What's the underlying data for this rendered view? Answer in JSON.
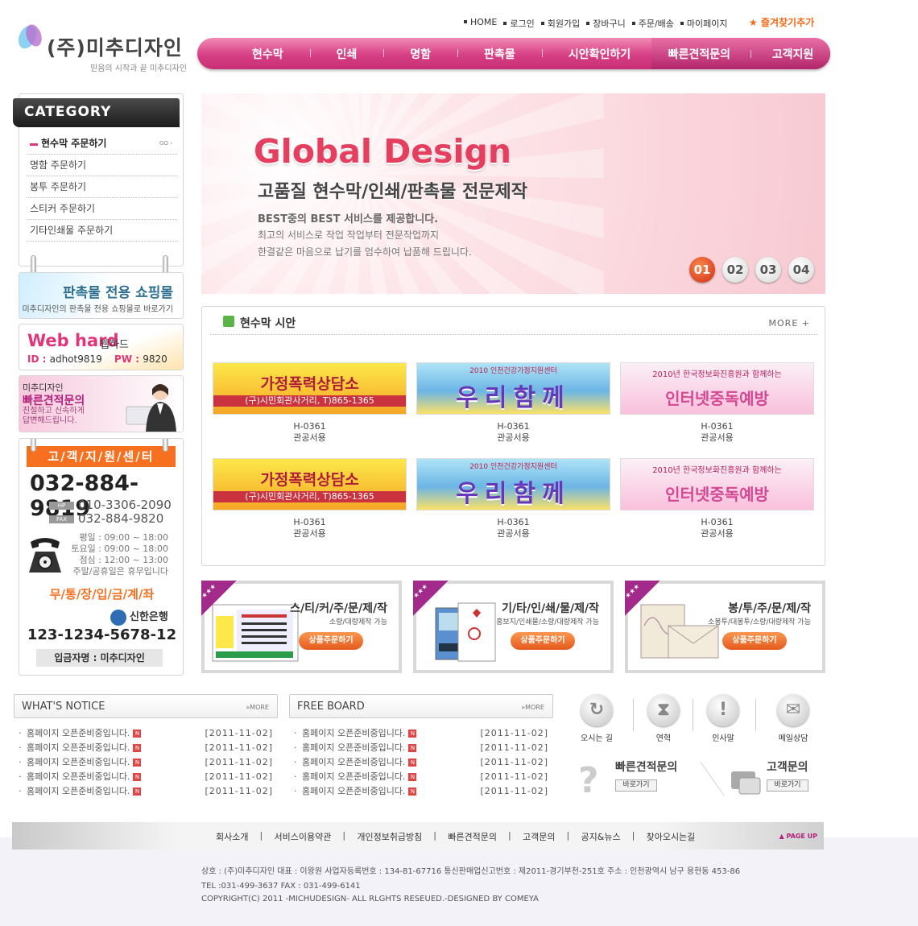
{
  "header": {
    "logo_name": "(주)미추디자인",
    "slogan": "믿음의 시작과 끝 미추디자인",
    "top_links": [
      "HOME",
      "로그인",
      "회원가입",
      "장바구니",
      "주문/배송",
      "마이페이지"
    ],
    "favorite": "★ 즐겨찾기추가",
    "gnb": [
      "현수막",
      "인쇄",
      "명함",
      "판촉물",
      "시안확인하기"
    ],
    "gnb_right": [
      "빠른견적문의",
      "고객지원"
    ],
    "colors": {
      "accent": "#d63f84",
      "orange": "#f6701f"
    }
  },
  "category": {
    "title": "CATEGORY",
    "items": [
      "현수막 주문하기",
      "명함 주문하기",
      "봉투 주문하기",
      "스티커 주문하기",
      "기타인쇄물 주문하기"
    ],
    "go": "GO ›"
  },
  "promo": {
    "shop_title": "판촉물 전용 쇼핑몰",
    "shop_sub": "미추디자인의 판촉물 전용 쇼핑몰로 바로가기",
    "web_title": "Web hard",
    "web_title2": "웹하드",
    "web_id_label": "ID : ",
    "web_id": "adhot9819",
    "web_pw_label": "PW : ",
    "web_pw": "9820",
    "quick_a": "미추디자인",
    "quick_b": "빠른견적문의",
    "quick_c": "친절하고 신속하게 답변해드립니다."
  },
  "cs": {
    "title": "고/객/지/원/센/터",
    "tel": "032-884-9819",
    "hp_label": "HP",
    "hp": "010-3306-2090",
    "fax_label": "FAX",
    "fax": "032-884-9820",
    "hours": [
      "평일 : 09:00 ~ 18:00",
      "토요일 : 09:00 ~ 18:00",
      "점심 : 12:00 ~ 13:00",
      "주말/공휴일은 휴무입니다"
    ],
    "bank_title": "무/통/장/입/금/계/좌",
    "bank": "신한은행",
    "account": "123-1234-5678-12",
    "holder": "입금자명 : 미추디자인"
  },
  "banner": {
    "title": "Global Design",
    "subtitle": "고품질 현수막/인쇄/판촉물 전문제작",
    "p1": "BEST중의 BEST 서비스를 제공합니다.",
    "p2": "최고의 서비스로 작업 작업부터 전문작업까지",
    "p3": "한결같은 마음으로 납기를 엄수하여 납품해 드립니다.",
    "pages": [
      "01",
      "02",
      "03",
      "04"
    ]
  },
  "samples": {
    "title": "현수막 시안",
    "more": "MORE +",
    "items": [
      {
        "code": "H-0361",
        "desc": "관공서용",
        "l1": "가정폭력상담소",
        "l2": "(구)시민회관사거리, T)865-1365"
      },
      {
        "code": "H-0361",
        "desc": "관공서용",
        "l1": "우리함께",
        "l2": "2010 인천건강가정지원센터"
      },
      {
        "code": "H-0361",
        "desc": "관공서용",
        "l1": "인터넷중독예방",
        "l2": "2010년 한국정보화진흥원과 함께하는"
      },
      {
        "code": "H-0361",
        "desc": "관공서용",
        "l1": "가정폭력상담소",
        "l2": "(구)시민회관사거리, T)865-1365"
      },
      {
        "code": "H-0361",
        "desc": "관공서용",
        "l1": "우리함께",
        "l2": "2010 인천건강가정지원센터"
      },
      {
        "code": "H-0361",
        "desc": "관공서용",
        "l1": "인터넷중독예방",
        "l2": "2010년 한국정보화진흥원과 함께하는"
      }
    ]
  },
  "products": [
    {
      "title": "스/티/커/주/문/제/작",
      "sub": "소량/대량제작 가능",
      "btn": "상품주문하기"
    },
    {
      "title": "기/타/인/쇄/물/제/작",
      "sub": "홍보지/인쇄물/소량/대량제작 가능",
      "btn": "상품주문하기"
    },
    {
      "title": "봉/투/주/문/제/작",
      "sub": "소봉투/대봉투/소량/대량제작 가능",
      "btn": "상품주문하기"
    }
  ],
  "notice": {
    "title": "WHAT'S  NOTICE",
    "more": "»MORE",
    "items": [
      {
        "t": "홈페이지 오픈준비중입니다.",
        "d": "[2011-11-02]"
      },
      {
        "t": "홈페이지 오픈준비중입니다.",
        "d": "[2011-11-02]"
      },
      {
        "t": "홈페이지 오픈준비중입니다.",
        "d": "[2011-11-02]"
      },
      {
        "t": "홈페이지 오픈준비중입니다.",
        "d": "[2011-11-02]"
      },
      {
        "t": "홈페이지 오픈준비중입니다.",
        "d": "[2011-11-02]"
      }
    ]
  },
  "board": {
    "title": "FREE  BOARD",
    "more": "»MORE",
    "items": [
      {
        "t": "홈페이지 오픈준비중입니다.",
        "d": "[2011-11-02]"
      },
      {
        "t": "홈페이지 오픈준비중입니다.",
        "d": "[2011-11-02]"
      },
      {
        "t": "홈페이지 오픈준비중입니다.",
        "d": "[2011-11-02]"
      },
      {
        "t": "홈페이지 오픈준비중입니다.",
        "d": "[2011-11-02]"
      },
      {
        "t": "홈페이지 오픈준비중입니다.",
        "d": "[2011-11-02]"
      }
    ]
  },
  "quick": {
    "icons": [
      "오시는 길",
      "연혁",
      "인사말",
      "메일상담"
    ],
    "quote": "빠른견적문의",
    "contact": "고객문의",
    "go": "바로가기"
  },
  "footer": {
    "links": [
      "회사소개",
      "서비스이용약관",
      "개인정보취급방침",
      "빠른견적문의",
      "고객문의",
      "공지&뉴스",
      "찾아오시는길"
    ],
    "page_up": "▲ PAGE UP",
    "info1": "상호 : (주)미추디자인    대표 : 이왕원    사업자등록번호 : 134-81-67716    통신판매업신고번호 : 제2011-경기부천-251호    주소 : 인천광역시 남구 용현동 453-86",
    "info2": "TEL :031-499-3637    FAX : 031-499-6141",
    "info3": "COPYRIGHT(C) 2011 -MICHUDESIGN-  ALL RLGHTS RESEUED.-DESIGNED BY COMEYA"
  }
}
